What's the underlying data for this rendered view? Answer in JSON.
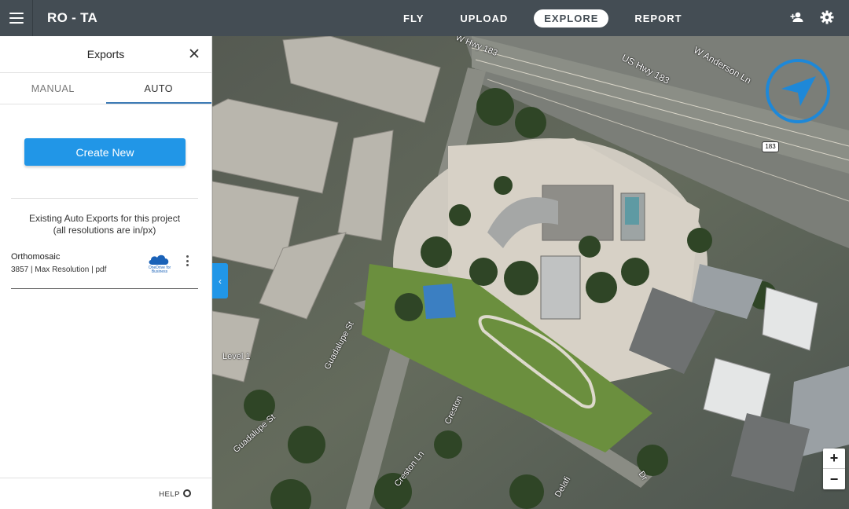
{
  "topbar": {
    "project_title": "RO - TA",
    "nav": [
      {
        "label": "FLY",
        "active": false
      },
      {
        "label": "UPLOAD",
        "active": false
      },
      {
        "label": "EXPLORE",
        "active": true
      },
      {
        "label": "REPORT",
        "active": false
      }
    ],
    "icons": [
      "menu-icon",
      "team-icon",
      "gear-icon"
    ]
  },
  "panel": {
    "title": "Exports",
    "tabs": [
      {
        "label": "MANUAL",
        "active": false
      },
      {
        "label": "AUTO",
        "active": true
      }
    ],
    "create_button": "Create New",
    "existing_line1": "Existing Auto Exports for this project",
    "existing_line2": "(all resolutions are in/px)",
    "exports": [
      {
        "name": "Orthomosaic",
        "meta": "3857 | Max Resolution | pdf",
        "destination": "OneDrive for Business"
      }
    ],
    "help": "HELP"
  },
  "map": {
    "labels": {
      "w_hwy_183": "W Hwy 183",
      "us_hwy_183": "US Hwy 183",
      "w_anderson": "W Anderson Ln",
      "shield": "183",
      "guadalupe_1": "Guadalupe St",
      "guadalupe_2": "Guadalupe St",
      "level": "Level 1",
      "creston_1": "Creston",
      "creston_2": "Creston Ln",
      "delafield": "Delafi",
      "dr": "Dr"
    },
    "zoom_in": "+",
    "zoom_out": "−",
    "colors": {
      "accent": "#2196e7",
      "compass": "#1e88d8"
    }
  }
}
